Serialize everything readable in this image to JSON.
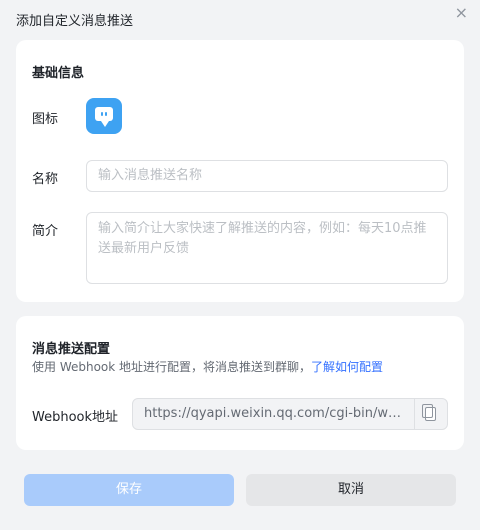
{
  "dialog": {
    "title": "添加自定义消息推送"
  },
  "basic": {
    "section_title": "基础信息",
    "icon_label": "图标",
    "name_label": "名称",
    "name_placeholder": "输入消息推送名称",
    "intro_label": "简介",
    "intro_placeholder": "输入简介让大家快速了解推送的内容，例如：每天10点推送最新用户反馈"
  },
  "config": {
    "section_title": "消息推送配置",
    "description": "使用 Webhook 地址进行配置，将消息推送到群聊，",
    "link_text": "了解如何配置",
    "webhook_label": "Webhook地址",
    "webhook_value": "https://qyapi.weixin.qq.com/cgi-bin/webhook/send"
  },
  "footer": {
    "save_label": "保存",
    "cancel_label": "取消"
  },
  "colors": {
    "primary": "#3370ff",
    "icon_bg": "#3ea2f2",
    "save_disabled": "#a9cbfb"
  },
  "icons": {
    "close": "close-icon",
    "app": "chat-bubble-icon",
    "copy": "copy-icon"
  }
}
